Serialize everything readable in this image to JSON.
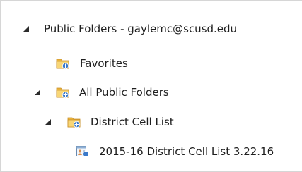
{
  "folder_tree": {
    "root": {
      "label": "Public Folders - gaylemc@scusd.edu",
      "icon": "expanded-triangle-icon"
    },
    "items": [
      {
        "label": "Favorites",
        "icon": "public-folder-icon"
      },
      {
        "label": "All Public Folders",
        "icon": "public-folder-icon"
      },
      {
        "label": "District Cell List",
        "icon": "public-folder-icon"
      },
      {
        "label": "2015-16 District Cell List 3.22.16",
        "icon": "contacts-folder-icon"
      }
    ]
  },
  "colors": {
    "text": "#1e1e1e",
    "expander": "#2b2b2b",
    "folder_yellow": "#f3c24c",
    "folder_blue": "#3a79c9"
  }
}
